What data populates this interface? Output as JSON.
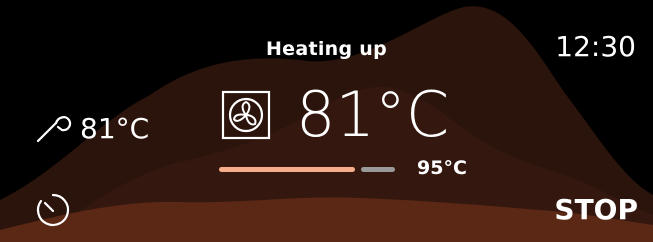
{
  "status": {
    "label": "Heating up"
  },
  "clock": {
    "time": "12:30"
  },
  "probe": {
    "icon": "meat-probe-icon",
    "temperature": "81°C"
  },
  "mode": {
    "icon": "fan-icon",
    "current_temperature": "81°C"
  },
  "heating_progress": {
    "fraction": 0.8,
    "fill_color": "#f6ad8c",
    "track_color": "#9a9a9a",
    "target_temperature": "95°C"
  },
  "controls": {
    "timer_icon": "timer-icon",
    "stop_label": "STOP"
  },
  "colors": {
    "background": "#000000",
    "wave_dark": "#2b140c",
    "wave_mid": "#4a2214",
    "wave_light": "#6b3018",
    "text": "#ffffff"
  }
}
